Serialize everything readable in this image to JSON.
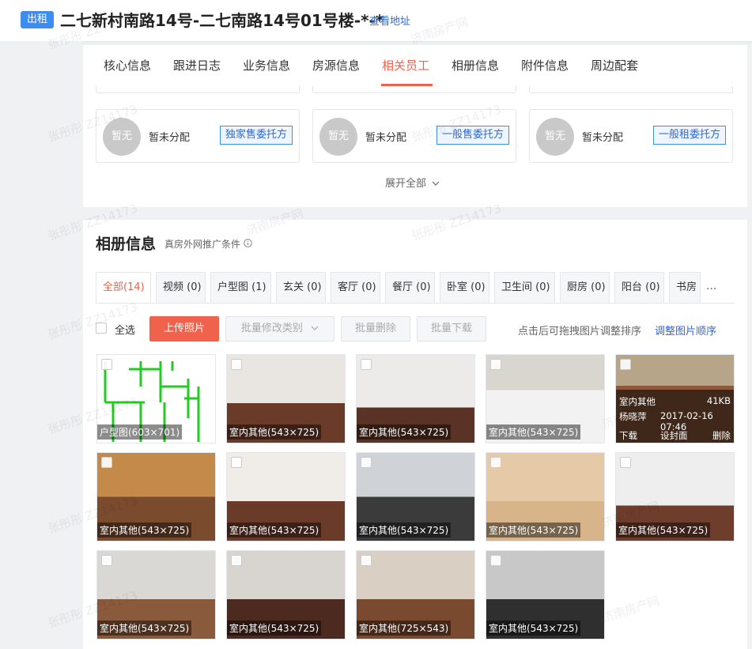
{
  "header": {
    "tag": "出租",
    "title": "二七新村南路14号-二七南路14号01号楼-*-*",
    "address_link": "查看地址"
  },
  "tabs": [
    "核心信息",
    "跟进日志",
    "业务信息",
    "房源信息",
    "相关员工",
    "相册信息",
    "附件信息",
    "周边配套"
  ],
  "active_tab": "相关员工",
  "staff": [
    {
      "avatar": "暂无",
      "name": "暂未分配",
      "role": "独家售委托方"
    },
    {
      "avatar": "暂无",
      "name": "暂未分配",
      "role": "一般售委托方"
    },
    {
      "avatar": "暂无",
      "name": "暂未分配",
      "role": "一般租委托方"
    }
  ],
  "expand_label": "展开全部",
  "album": {
    "title": "相册信息",
    "subtitle": "真房外网推广条件",
    "categories": [
      "全部(14)",
      "视频 (0)",
      "户型图 (1)",
      "玄关 (0)",
      "客厅 (0)",
      "餐厅 (0)",
      "卧室 (0)",
      "卫生间 (0)",
      "厨房 (0)",
      "阳台 (0)",
      "书房"
    ],
    "more": "···",
    "select_all": "全选",
    "upload": "上传照片",
    "batch_edit": "批量修改类别",
    "batch_delete": "批量删除",
    "batch_download": "批量下载",
    "hint": "点击后可拖拽图片调整排序",
    "hint_link": "调整图片顺序",
    "photos": [
      {
        "label": "户型图(603×701)",
        "kind": "floorplan"
      },
      {
        "label": "室内其他(543×725)",
        "kind": "room1"
      },
      {
        "label": "室内其他(543×725)",
        "kind": "room2"
      },
      {
        "label": "室内其他(543×725)",
        "kind": "kitchen"
      },
      {
        "label": "室内其他",
        "kind": "balcony",
        "hover": true
      },
      {
        "label": "室内其他(543×725)",
        "kind": "sofa"
      },
      {
        "label": "室内其他(543×725)",
        "kind": "messy"
      },
      {
        "label": "室内其他(543×725)",
        "kind": "bath"
      },
      {
        "label": "室内其他(543×725)",
        "kind": "person"
      },
      {
        "label": "室内其他(543×725)",
        "kind": "empty"
      },
      {
        "label": "室内其他(543×725)",
        "kind": "bedroom"
      },
      {
        "label": "室内其他(543×725)",
        "kind": "dark"
      },
      {
        "label": "室内其他(725×543)",
        "kind": "hall"
      },
      {
        "label": "室内其他(543×725)",
        "kind": "bath2"
      }
    ],
    "hover_info": {
      "category": "室内其他",
      "size": "41KB",
      "uploader": "杨晓萍",
      "time": "2017-02-16 07:46",
      "download": "下载",
      "set_cover": "设封面",
      "delete": "删除"
    }
  },
  "watermarks": [
    "张彤彤 ZZ14173",
    "济南房产网"
  ],
  "colors": {
    "accent": "#f0624c",
    "link": "#3068d0",
    "tag": "#3d8df0"
  }
}
